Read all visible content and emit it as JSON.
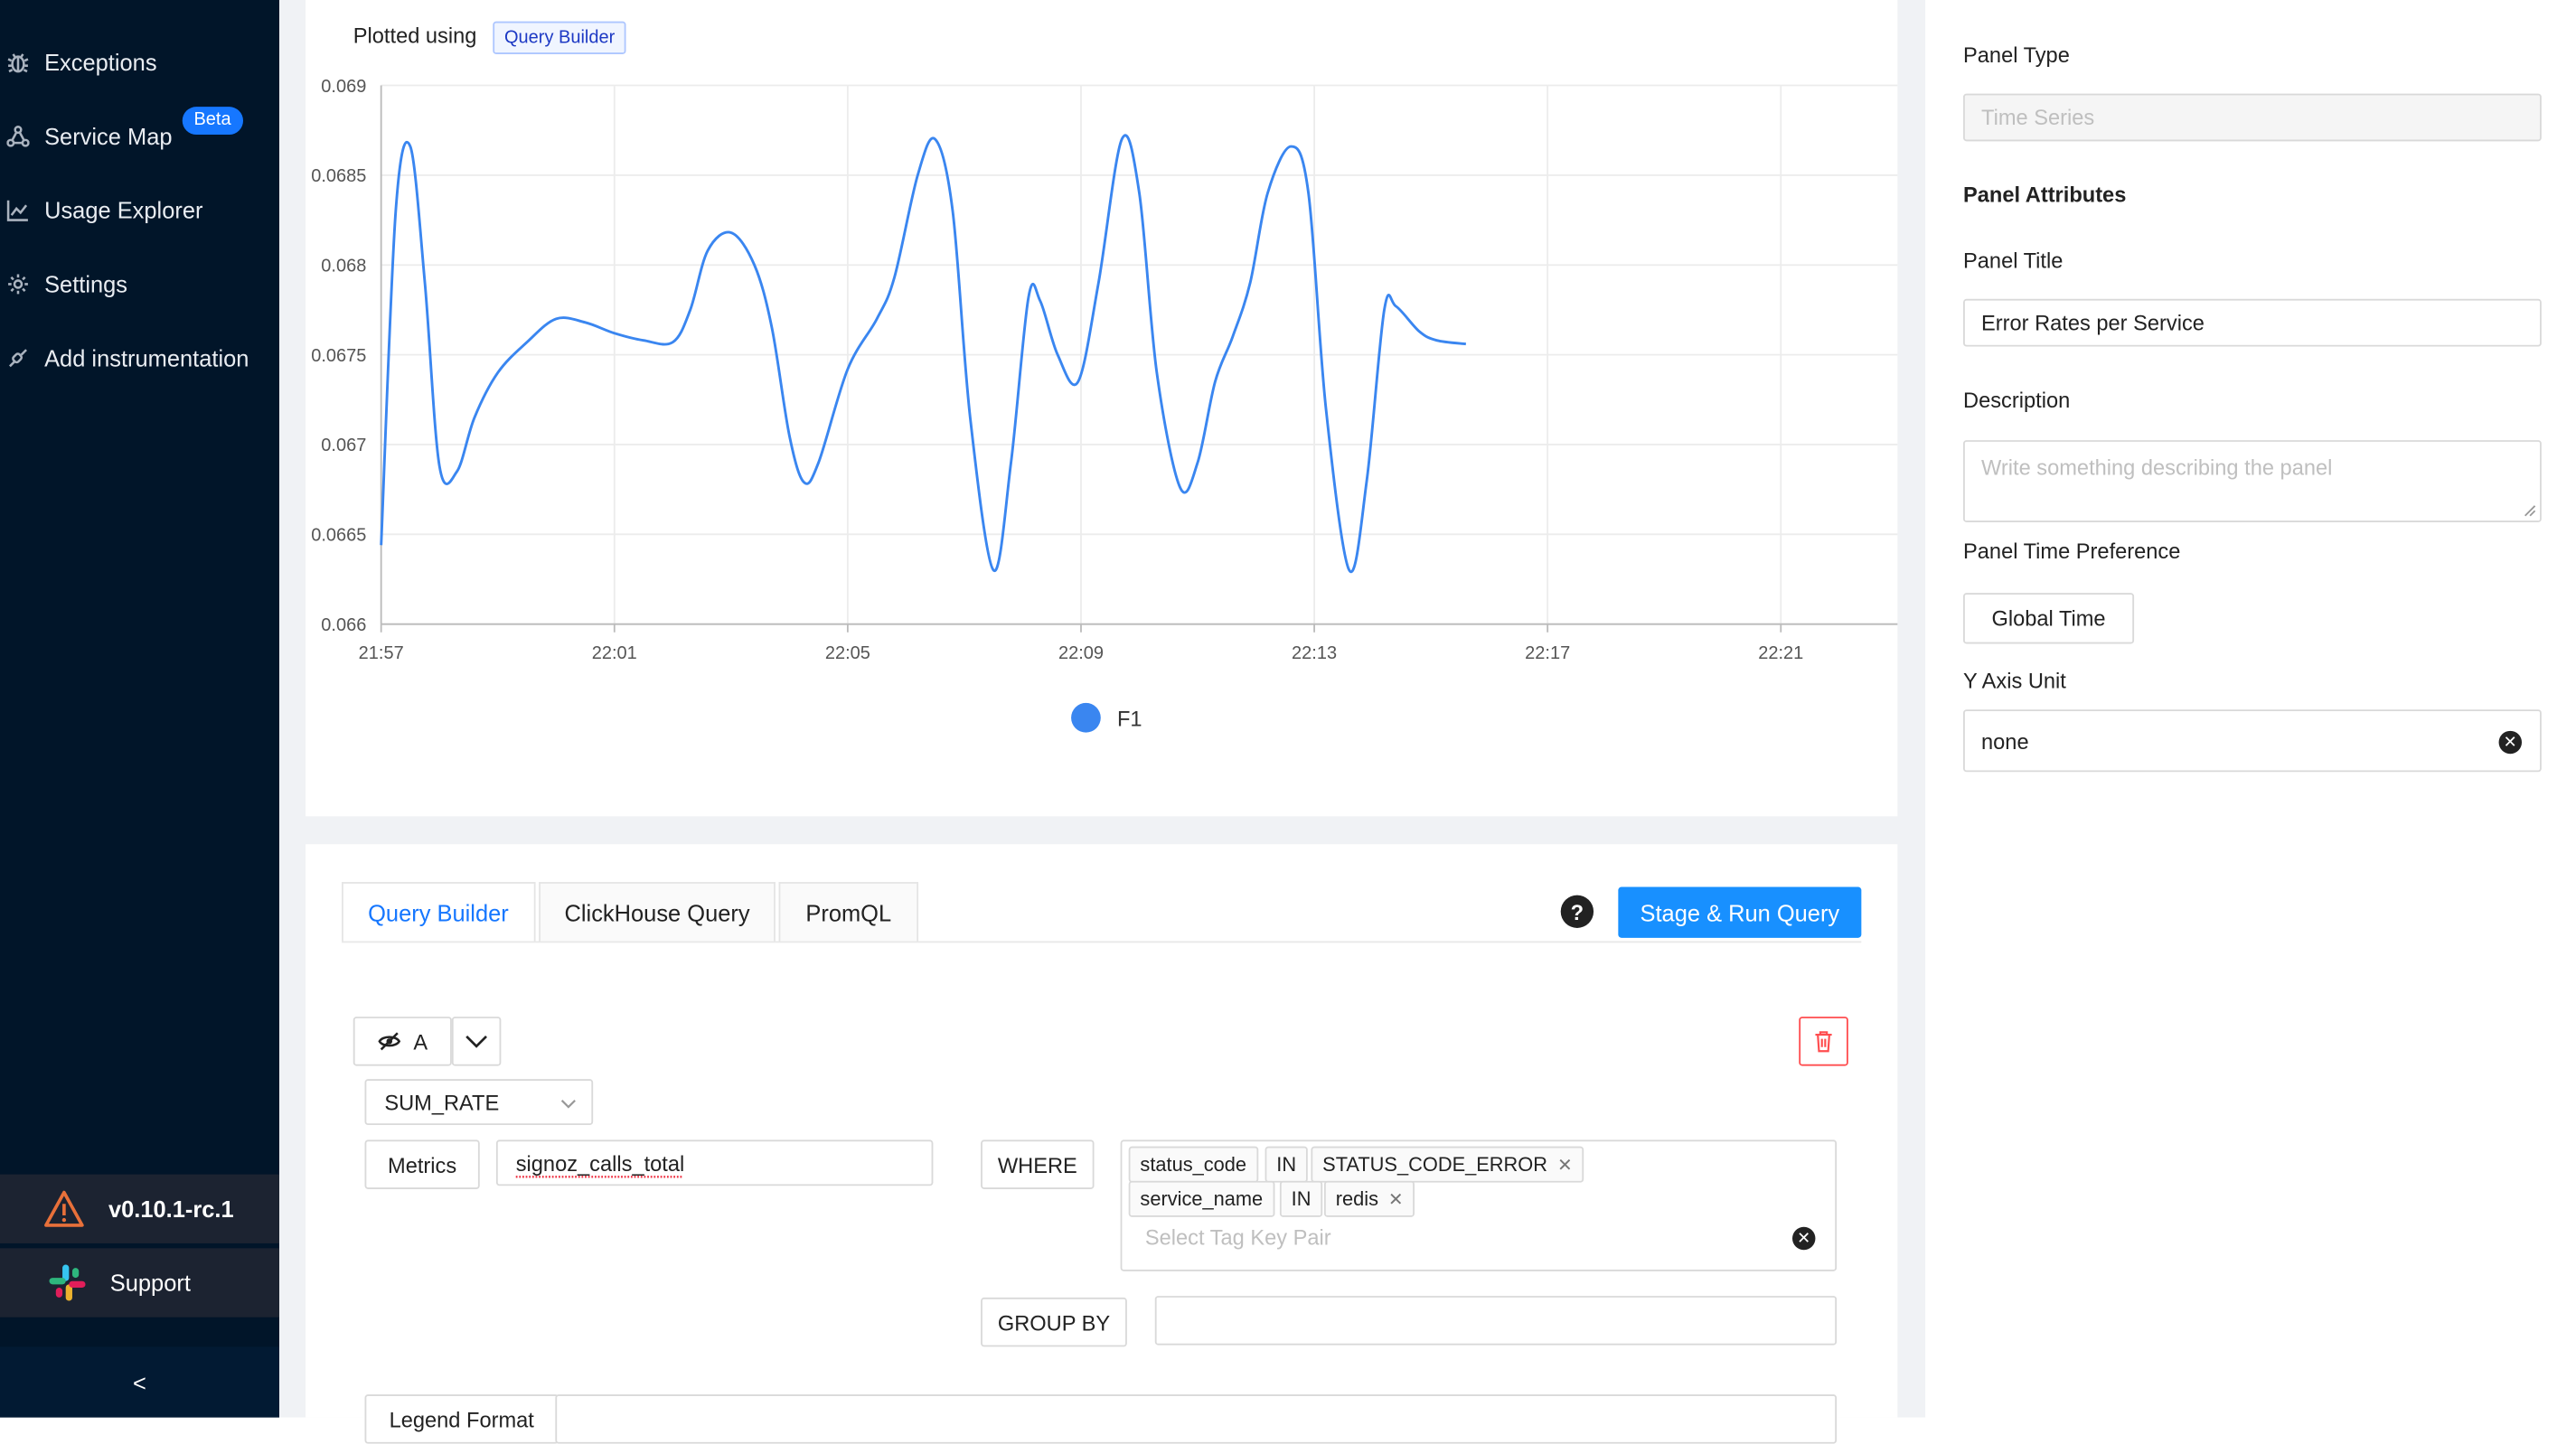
{
  "sidebar": {
    "items": [
      {
        "label": "Exceptions",
        "icon": "bug-icon"
      },
      {
        "label": "Service Map",
        "icon": "deployment-icon"
      },
      {
        "label": "Usage Explorer",
        "icon": "line-chart-icon"
      },
      {
        "label": "Settings",
        "icon": "gear-icon"
      },
      {
        "label": "Add instrumentation",
        "icon": "api-icon"
      }
    ],
    "beta_badge": "Beta",
    "version": "v0.10.1-rc.1",
    "support": "Support",
    "collapse": "<"
  },
  "chart_header": {
    "plotted_using": "Plotted using",
    "builder_tag": "Query Builder"
  },
  "chart_data": {
    "type": "line",
    "x": [
      "21:57",
      "22:01",
      "22:05",
      "22:09",
      "22:13",
      "22:17",
      "22:21"
    ],
    "ylim": [
      0.066,
      0.069
    ],
    "yticks": [
      "0.069",
      "0.0685",
      "0.068",
      "0.0675",
      "0.067",
      "0.0665",
      "0.066"
    ],
    "series": [
      {
        "name": "F1",
        "color": "#3a86f0",
        "points": [
          [
            0.0,
            0.06644
          ],
          [
            0.25,
            0.0683
          ],
          [
            0.5,
            0.06866
          ],
          [
            0.75,
            0.0679
          ],
          [
            1.0,
            0.06688
          ],
          [
            1.3,
            0.06685
          ],
          [
            1.6,
            0.06715
          ],
          [
            2.0,
            0.0674
          ],
          [
            2.5,
            0.06757
          ],
          [
            3.0,
            0.0677
          ],
          [
            3.5,
            0.06768
          ],
          [
            4.0,
            0.06762
          ],
          [
            4.5,
            0.06758
          ],
          [
            5.0,
            0.06757
          ],
          [
            5.3,
            0.06775
          ],
          [
            5.6,
            0.06808
          ],
          [
            6.0,
            0.06818
          ],
          [
            6.4,
            0.068
          ],
          [
            6.7,
            0.06765
          ],
          [
            7.0,
            0.06705
          ],
          [
            7.25,
            0.06679
          ],
          [
            7.5,
            0.0669
          ],
          [
            8.0,
            0.06742
          ],
          [
            8.5,
            0.0677
          ],
          [
            8.8,
            0.06793
          ],
          [
            9.2,
            0.0685
          ],
          [
            9.5,
            0.0687
          ],
          [
            9.8,
            0.0683
          ],
          [
            10.1,
            0.06715
          ],
          [
            10.5,
            0.0663
          ],
          [
            10.8,
            0.0669
          ],
          [
            11.1,
            0.06782
          ],
          [
            11.3,
            0.0678
          ],
          [
            11.6,
            0.0675
          ],
          [
            11.95,
            0.06735
          ],
          [
            12.3,
            0.0679
          ],
          [
            12.7,
            0.0687
          ],
          [
            13.0,
            0.0684
          ],
          [
            13.3,
            0.0674
          ],
          [
            13.7,
            0.06676
          ],
          [
            14.0,
            0.0669
          ],
          [
            14.3,
            0.06735
          ],
          [
            14.6,
            0.0676
          ],
          [
            14.9,
            0.0679
          ],
          [
            15.2,
            0.0684
          ],
          [
            15.6,
            0.06866
          ],
          [
            15.9,
            0.0684
          ],
          [
            16.2,
            0.0672
          ],
          [
            16.6,
            0.0663
          ],
          [
            16.9,
            0.0668
          ],
          [
            17.2,
            0.06775
          ],
          [
            17.4,
            0.06777
          ],
          [
            17.8,
            0.06763
          ],
          [
            18.1,
            0.06758
          ],
          [
            18.6,
            0.06756
          ]
        ]
      }
    ]
  },
  "query_tabs": [
    "Query Builder",
    "ClickHouse Query",
    "PromQL"
  ],
  "help_symbol": "?",
  "run_button": "Stage & Run Query",
  "query": {
    "name": "A",
    "aggregation": "SUM_RATE",
    "metrics_label": "Metrics",
    "metric_value": "signoz_calls_total",
    "where_label": "WHERE",
    "tags": [
      {
        "key": "status_code",
        "op": "IN",
        "value": "STATUS_CODE_ERROR"
      },
      {
        "key": "service_name",
        "op": "IN",
        "value": "redis"
      }
    ],
    "tag_placeholder": "Select Tag Key Pair",
    "group_by_label": "GROUP BY",
    "legend_format_label": "Legend Format"
  },
  "right_panel": {
    "panel_type_label": "Panel Type",
    "panel_type_value": "Time Series",
    "attributes_heading": "Panel Attributes",
    "title_label": "Panel Title",
    "title_value": "Error Rates per Service",
    "description_label": "Description",
    "description_placeholder": "Write something describing the  panel",
    "time_pref_label": "Panel Time Preference",
    "time_pref_value": "Global Time",
    "y_unit_label": "Y Axis Unit",
    "y_unit_value": "none"
  }
}
